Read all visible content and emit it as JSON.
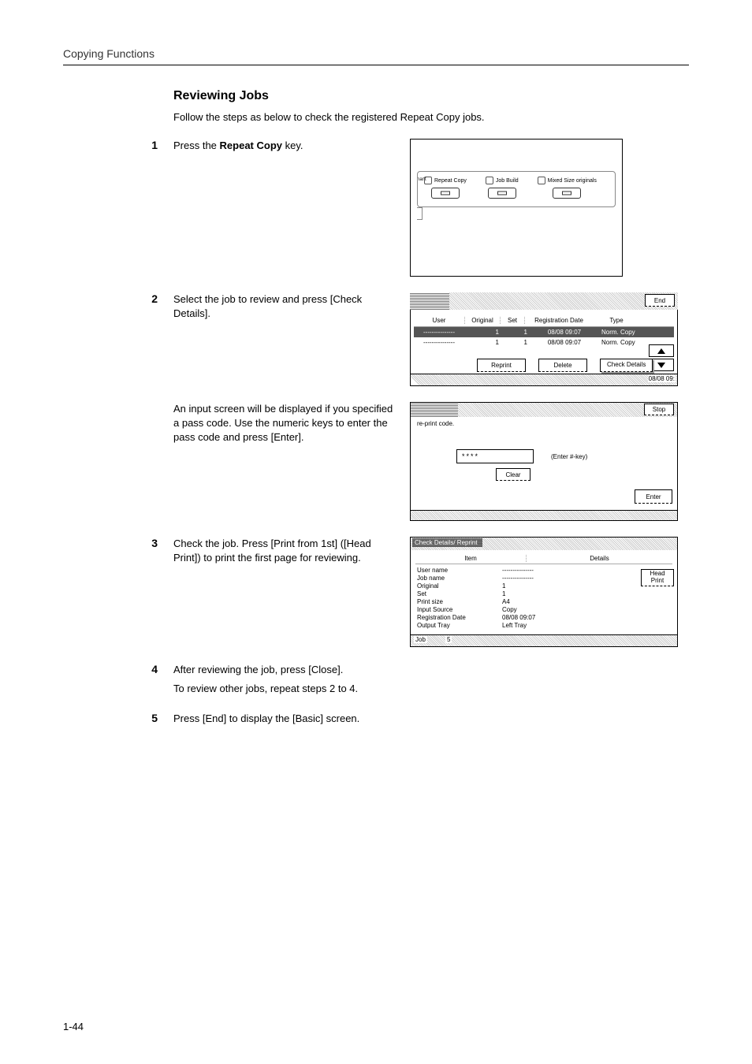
{
  "running_head": "Copying Functions",
  "section_title": "Reviewing Jobs",
  "intro": "Follow the steps as below to check the registered Repeat Copy jobs.",
  "page_number": "1-44",
  "steps": {
    "1": {
      "num": "1",
      "text_a": "Press the ",
      "bold": "Repeat Copy",
      "text_b": " key."
    },
    "2": {
      "num": "2",
      "text": "Select the job to review and press [Check Details].",
      "sub": "An input screen will be displayed if you specified a pass code. Use the numeric keys to enter the pass code and press [Enter]."
    },
    "3": {
      "num": "3",
      "text": "Check the job. Press [Print from 1st] ([Head Print]) to print the first page for reviewing."
    },
    "4": {
      "num": "4",
      "text": "After reviewing the job, press [Close].",
      "sub": "To review other jobs, repeat steps 2 to 4."
    },
    "5": {
      "num": "5",
      "text": "Press [End] to display the [Basic] screen."
    }
  },
  "hw": {
    "nant": "nant",
    "k1": "Repeat Copy",
    "k2": "Job Build",
    "k3": "Mixed Size originals"
  },
  "list": {
    "end": "End",
    "head": {
      "user": "User",
      "orig": "Original",
      "set": "Set",
      "reg": "Registration Date",
      "type": "Type"
    },
    "r1": {
      "user": "---------------",
      "orig": "1",
      "set": "1",
      "reg": "08/08  09:07",
      "type": "Norm. Copy"
    },
    "r2": {
      "user": "---------------",
      "orig": "1",
      "set": "1",
      "reg": "08/08  09:07",
      "type": "Norm. Copy"
    },
    "reprint": "Reprint",
    "delete": "Delete",
    "check": "Check Details",
    "foot_time": "08/08 09:"
  },
  "pass": {
    "stop": "Stop",
    "label": "re-print code.",
    "value": "****",
    "hint": "(Enter #-key)",
    "clear": "Clear",
    "enter": "Enter"
  },
  "det": {
    "title": "Check Details/ Reprint",
    "h1": "Item",
    "h2": "Details",
    "rows": {
      "r1": {
        "k": "User name",
        "v": "---------------"
      },
      "r2": {
        "k": "Job name",
        "v": "---------------"
      },
      "r3": {
        "k": "Original",
        "v": "1"
      },
      "r4": {
        "k": "Set",
        "v": "1"
      },
      "r5": {
        "k": "Print size",
        "v": "A4"
      },
      "r6": {
        "k": "Input Source",
        "v": "Copy"
      },
      "r7": {
        "k": "Registration Date",
        "v": "08/08 09:07"
      },
      "r8": {
        "k": "Output Tray",
        "v": "Left Tray"
      }
    },
    "head_print_a": "Head",
    "head_print_b": "Print",
    "foot_job": "Job",
    "foot_n": "5"
  }
}
